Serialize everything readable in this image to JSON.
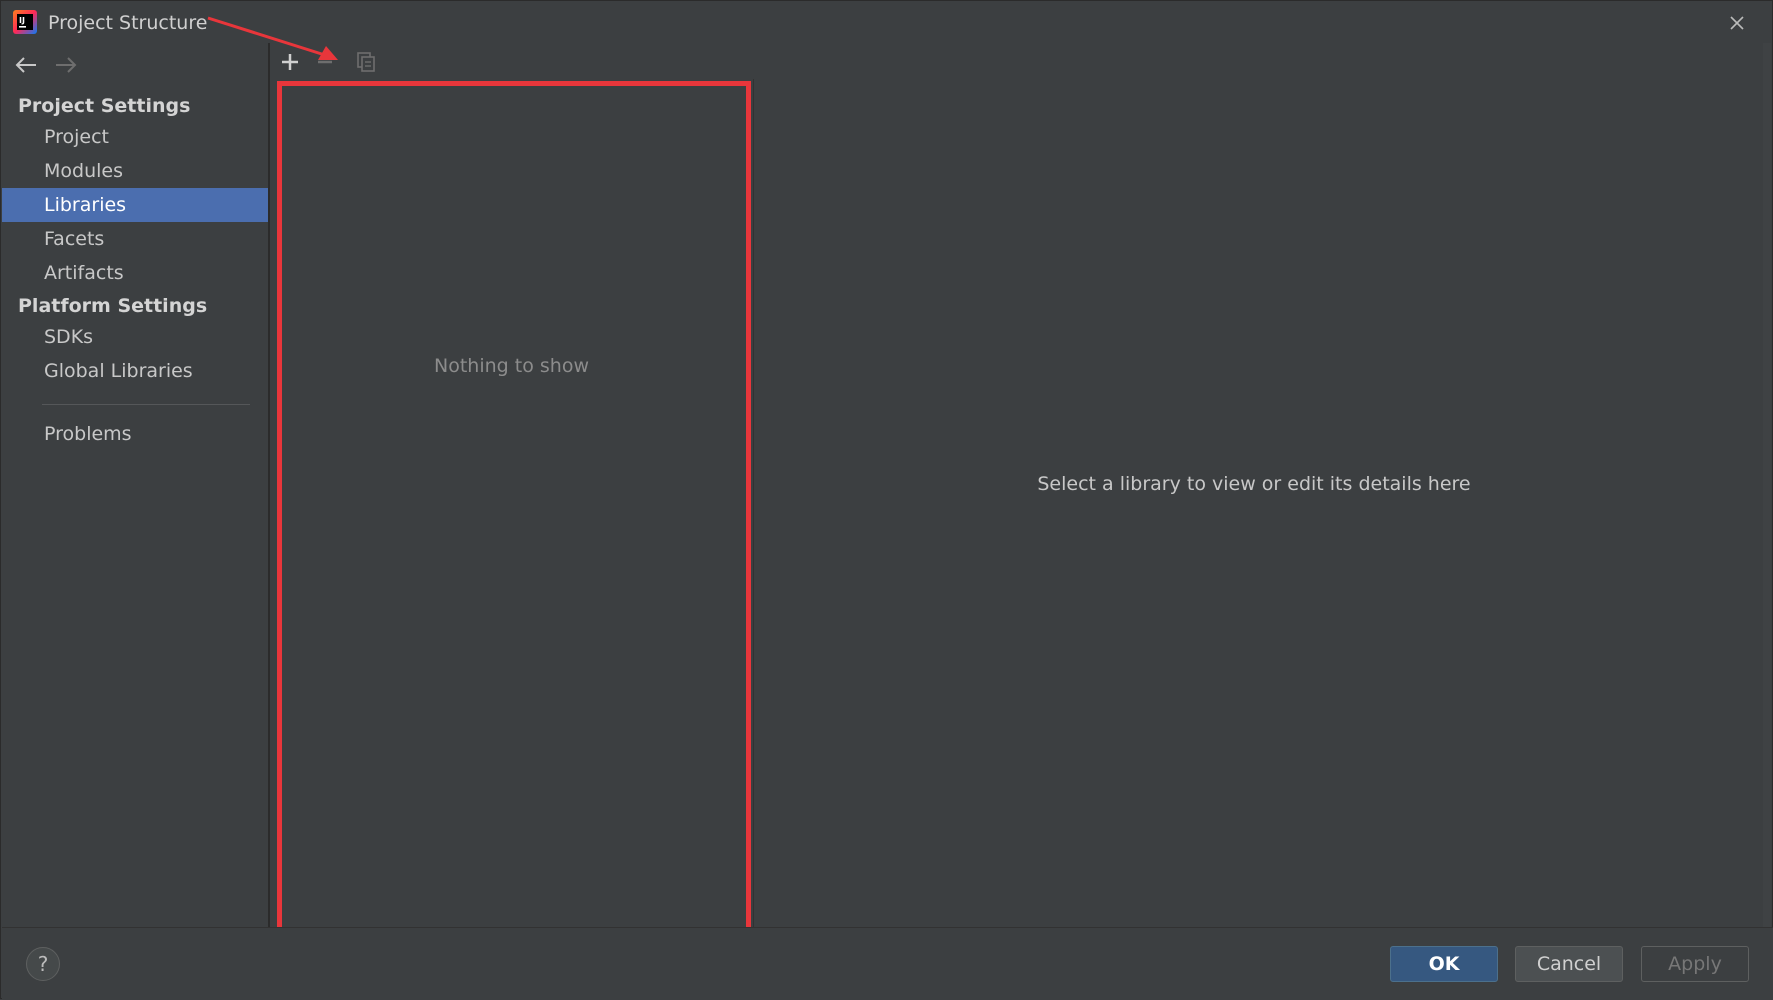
{
  "window": {
    "title": "Project Structure"
  },
  "nav": {
    "back_icon": "arrow-left-icon",
    "forward_icon": "arrow-right-icon"
  },
  "sidebar": {
    "project_settings_header": "Project Settings",
    "project_items": [
      {
        "label": "Project"
      },
      {
        "label": "Modules"
      },
      {
        "label": "Libraries",
        "selected": true
      },
      {
        "label": "Facets"
      },
      {
        "label": "Artifacts"
      }
    ],
    "platform_settings_header": "Platform Settings",
    "platform_items": [
      {
        "label": "SDKs"
      },
      {
        "label": "Global Libraries"
      }
    ],
    "problems_label": "Problems"
  },
  "list_toolbar": {
    "add_icon": "plus-icon",
    "remove_icon": "minus-icon",
    "copy_icon": "copy-icon"
  },
  "list": {
    "empty_text": "Nothing to show"
  },
  "details": {
    "placeholder": "Select a library to view or edit its details here"
  },
  "footer": {
    "help_label": "?",
    "ok_label": "OK",
    "cancel_label": "Cancel",
    "apply_label": "Apply"
  },
  "colors": {
    "background": "#3c3f41",
    "selection": "#4b6eaf",
    "ok_button": "#365880",
    "annotation_red": "#e8363b"
  }
}
